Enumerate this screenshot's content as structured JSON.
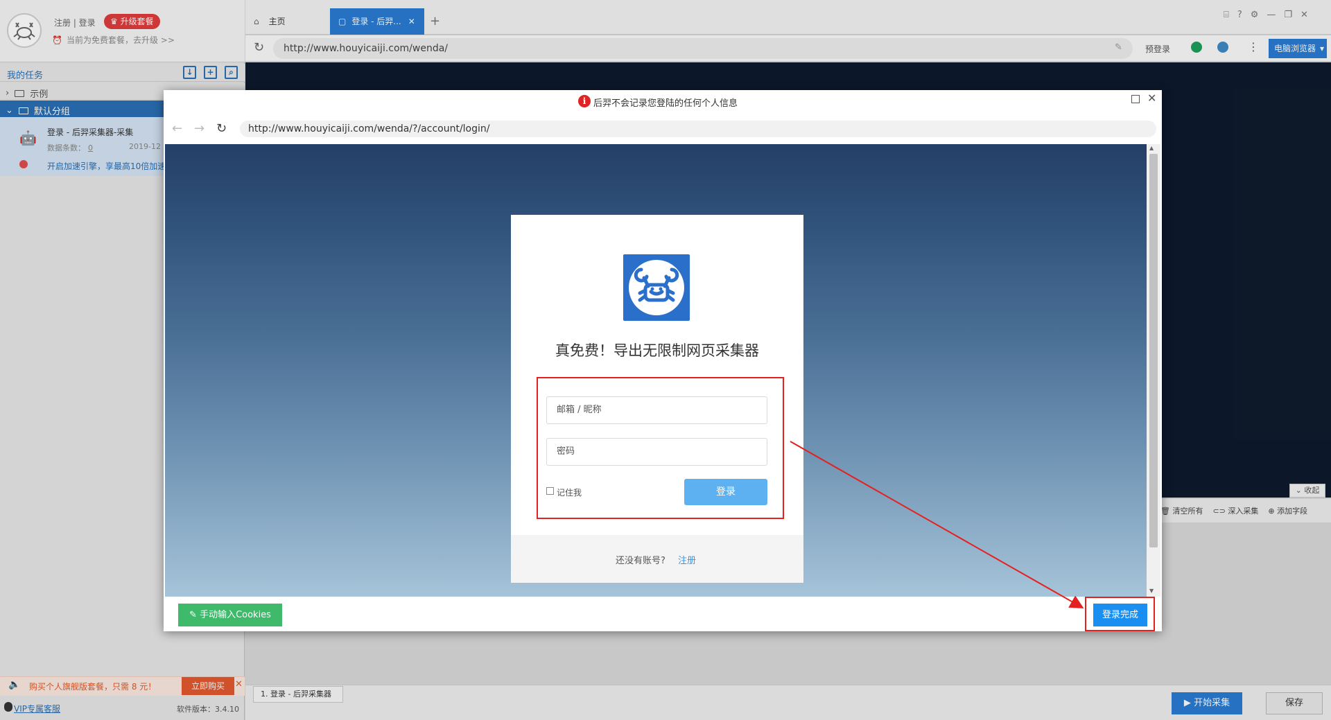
{
  "user": {
    "register_login": "注册 | 登录",
    "upgrade": "升级套餐",
    "free_note": "当前为免费套餐，去升级 >>"
  },
  "sidebar": {
    "my_tasks": "我的任务",
    "groups": [
      {
        "label": "示例"
      },
      {
        "label": "默认分组"
      }
    ],
    "task": {
      "title": "登录 - 后羿采集器-采集",
      "count_label": "数据条数：",
      "count_value": "0",
      "date": "2019-12"
    },
    "speed_tip": "开启加速引擎，享最高10倍加速",
    "promo": "购买个人旗舰版套餐，只需 8 元！",
    "buy_now": "立即购买",
    "vip": "VIP专属客服",
    "version": "软件版本：3.4.10"
  },
  "tabs": {
    "home": "主页",
    "login": "登录 - 后羿..."
  },
  "address_bar": {
    "url": "http://www.houyicaiji.com/wenda/",
    "prelogin": "预登录",
    "pc_browser": "电脑浏览器"
  },
  "tools": {
    "collapse": "收起",
    "clear_all": "清空所有",
    "deep_collect": "深入采集",
    "add_field": "添加字段"
  },
  "bottom": {
    "task_tab": "1. 登录 - 后羿采集器",
    "start": "开始采集",
    "save": "保存"
  },
  "dialog": {
    "notice": "后羿不会记录您登陆的任何个人信息",
    "url": "http://www.houyicaiji.com/wenda/?/account/login/",
    "slogan": "真免费！导出无限制网页采集器",
    "email_placeholder": "邮箱 / 昵称",
    "password_placeholder": "密码",
    "remember": "记住我",
    "login": "登录",
    "no_account": "还没有账号?",
    "register": "注册",
    "cookies_button": "手动输入Cookies",
    "done_button": "登录完成"
  },
  "colors": {
    "accent_blue": "#2a7bd3",
    "annotation_red": "#e52020",
    "cookie_green": "#3fb96a"
  }
}
